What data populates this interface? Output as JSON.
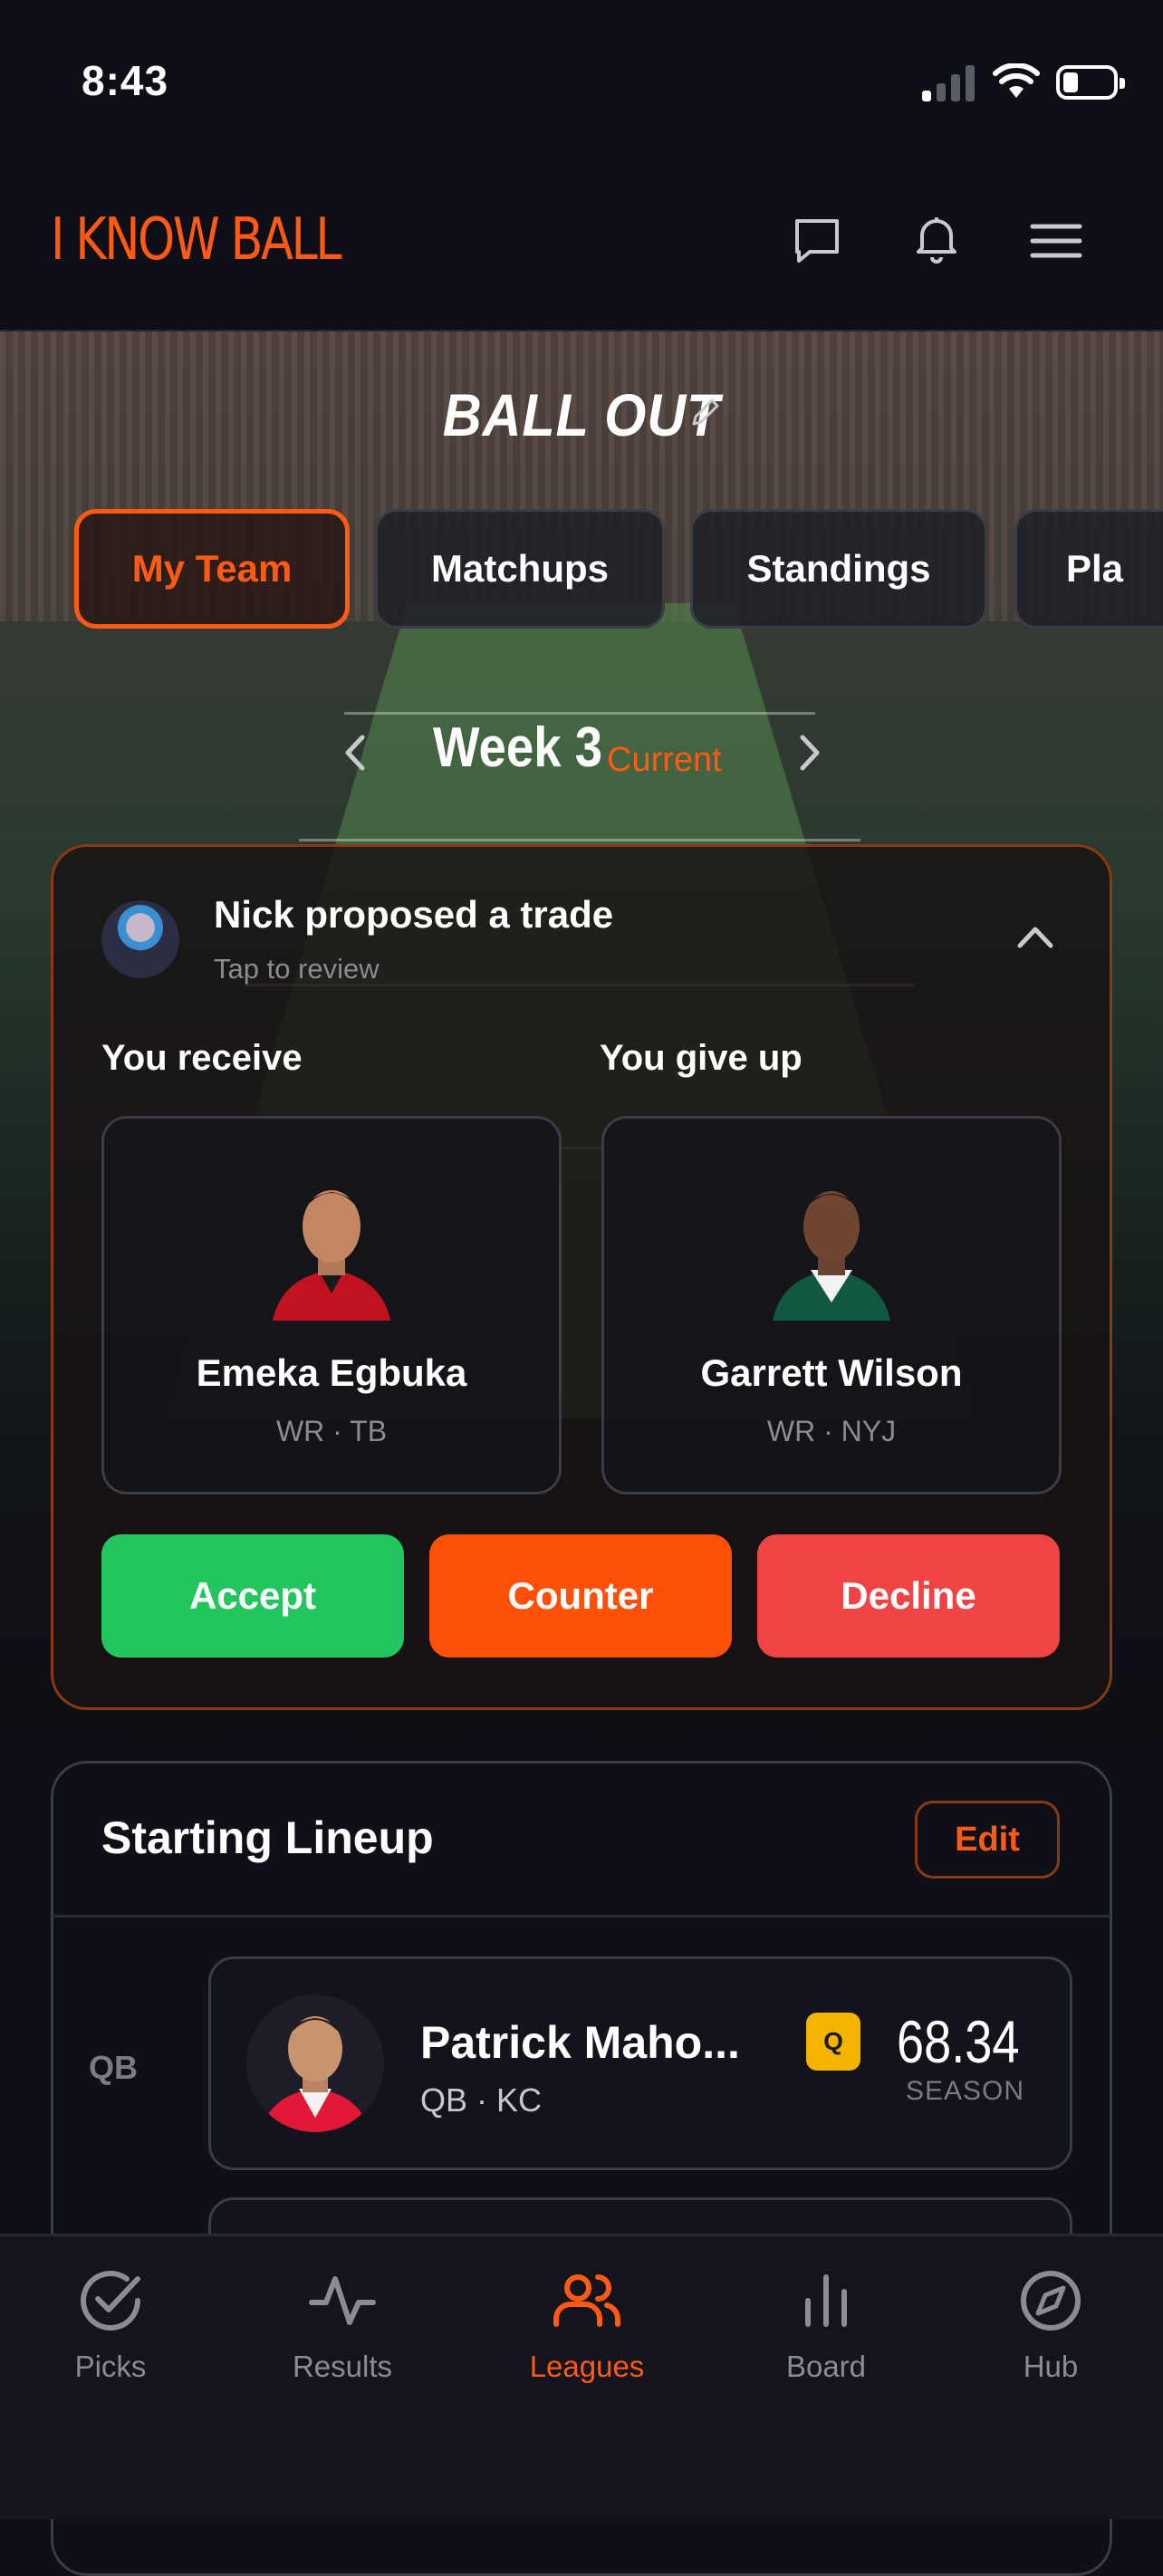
{
  "status": {
    "time": "8:43"
  },
  "header": {
    "brand": "I KNOW BALL"
  },
  "league": {
    "name": "BALL OUT"
  },
  "tabs": [
    {
      "label": "My Team",
      "active": true
    },
    {
      "label": "Matchups",
      "active": false
    },
    {
      "label": "Standings",
      "active": false
    },
    {
      "label": "Pla",
      "active": false
    }
  ],
  "week": {
    "label": "Week 3",
    "status": "Current"
  },
  "trade": {
    "title": "Nick proposed a trade",
    "subtitle": "Tap to review",
    "receive_label": "You receive",
    "give_label": "You give up",
    "receive_player": {
      "name": "Emeka Egbuka",
      "pos": "WR · TB"
    },
    "give_player": {
      "name": "Garrett Wilson",
      "pos": "WR · NYJ"
    },
    "actions": {
      "accept": "Accept",
      "counter": "Counter",
      "decline": "Decline"
    }
  },
  "lineup": {
    "title": "Starting Lineup",
    "edit_label": "Edit",
    "rows": [
      {
        "slot": "QB",
        "name": "Patrick Maho...",
        "pos": "QB · KC",
        "badge": "Q",
        "score": "68.34",
        "score_label": "SEASON"
      }
    ]
  },
  "nav": [
    {
      "label": "Picks",
      "icon": "check-circle-icon",
      "active": false
    },
    {
      "label": "Results",
      "icon": "activity-icon",
      "active": false
    },
    {
      "label": "Leagues",
      "icon": "users-icon",
      "active": true
    },
    {
      "label": "Board",
      "icon": "bar-chart-icon",
      "active": false
    },
    {
      "label": "Hub",
      "icon": "compass-icon",
      "active": false
    }
  ],
  "colors": {
    "accent": "#ff5a14",
    "accept": "#22c55e",
    "decline": "#ef4444",
    "badge": "#f5b400"
  }
}
